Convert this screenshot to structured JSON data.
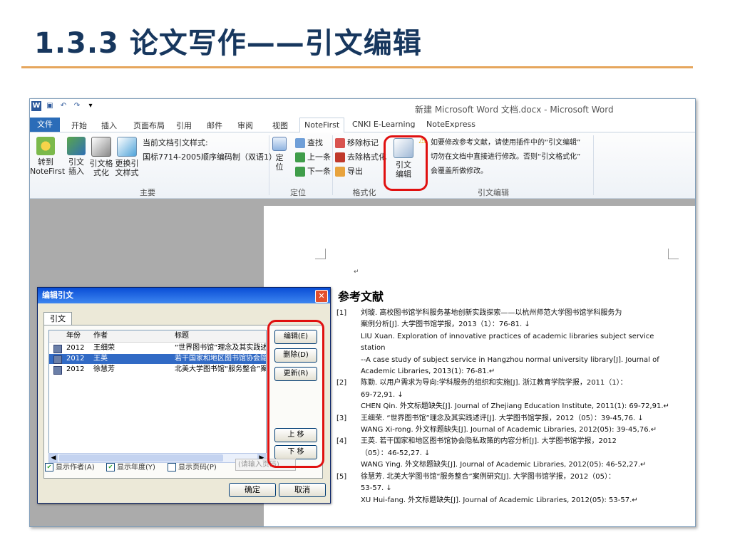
{
  "slide": {
    "title": "1.3.3  论文写作——引文编辑"
  },
  "word": {
    "window_title": "新建 Microsoft Word 文档.docx - Microsoft Word",
    "tabs": [
      "文件",
      "开始",
      "插入",
      "页面布局",
      "引用",
      "邮件",
      "审阅",
      "视图",
      "NoteFirst",
      "CNKI E-Learning",
      "NoteExpress"
    ],
    "active_tab": "NoteFirst",
    "ribbon": {
      "main": {
        "label": "主要",
        "convert": "转到\nNoteFirst",
        "cite_insert": "引文\n插入",
        "cite_format": "引文格\n式化",
        "change_style": "更换引\n文样式",
        "style_caption": "当前文档引文样式:",
        "style_value": "国标7714-2005顺序编码制（双语1）"
      },
      "locate": {
        "label": "定位",
        "locate_btn": "定\n位",
        "find": "查找",
        "prev": "上一条",
        "next": "下一条"
      },
      "format": {
        "label": "格式化",
        "remove_mark": "移除标记",
        "remove_format": "去除格式化",
        "export": "导出"
      },
      "edit": {
        "label": "引文编辑",
        "edit_btn": "引文\n编辑",
        "note_line1": "如要修改参考文献，请使用插件中的“引文编辑”",
        "note_line2": "切勿在文档中直接进行修改。否则“引文格式化”",
        "note_line3": "会覆盖所做修改。"
      }
    },
    "document": {
      "heading": "参考文献",
      "references": [
        {
          "num": "[1]",
          "lines": [
            "刘璇. 高校图书馆学科服务基地创新实践探索——以杭州师范大学图书馆学科服务为",
            "案例分析[J]. 大学图书馆学报，2013（1）：76-81. ↓",
            "LIU Xuan. Exploration of innovative practices of academic libraries subject service station",
            "--A case study of subject service in Hangzhou normal university library[J]. Journal of",
            "Academic Libraries, 2013(1): 76-81.↵"
          ]
        },
        {
          "num": "[2]",
          "lines": [
            "陈勤. 以用户需求为导向:学科服务的组织和实施[J]. 浙江教育学院学报，2011（1）：",
            "69-72,91. ↓",
            "CHEN Qin. 外文标题缺失[J]. Journal of Zhejiang Education Institute, 2011(1): 69-72,91.↵"
          ]
        },
        {
          "num": "[3]",
          "lines": [
            "王细荣. “世界图书馆”理念及其实践述评[J]. 大学图书馆学报，2012（05）：39-45,76. ↓",
            "WANG Xi-rong. 外文标题缺失[J]. Journal of Academic Libraries, 2012(05): 39-45,76.↵"
          ]
        },
        {
          "num": "[4]",
          "lines": [
            "王英. 若干国家和地区图书馆协会隐私政策的内容分析[J]. 大学图书馆学报，2012",
            "（05）：46-52,27. ↓",
            "WANG Ying. 外文标题缺失[J]. Journal of Academic Libraries, 2012(05): 46-52,27.↵"
          ]
        },
        {
          "num": "[5]",
          "lines": [
            "徐慧芳. 北美大学图书馆“服务整合”案例研究[J]. 大学图书馆学报，2012（05）：",
            "53-57. ↓",
            "XU Hui-fang. 外文标题缺失[J]. Journal of Academic Libraries, 2012(05): 53-57.↵"
          ]
        }
      ]
    },
    "dialog": {
      "title": "编辑引文",
      "close": "✕",
      "tab": "引文",
      "columns": {
        "year": "年份",
        "author": "作者",
        "title": "标题"
      },
      "rows": [
        {
          "year": "2012",
          "author": "王细荣",
          "title": "“世界图书馆”理念及其实践述评",
          "selected": false
        },
        {
          "year": "2012",
          "author": "王英",
          "title": "若干国家和地区图书馆协会隐私政策",
          "selected": true
        },
        {
          "year": "2012",
          "author": "徐慧芳",
          "title": "北美大学图书馆“服务整合”案例研究",
          "selected": false
        }
      ],
      "buttons": {
        "edit": "编辑(E)",
        "delete": "删除(D)",
        "update": "更新(R)",
        "up": "上 移",
        "down": "下 移"
      },
      "options": {
        "show_author": "显示作者(A)",
        "show_year": "显示年度(Y)",
        "show_page": "显示页码(P)",
        "page_placeholder": "(请输入页码)"
      },
      "ok": "确定",
      "cancel": "取消"
    }
  }
}
